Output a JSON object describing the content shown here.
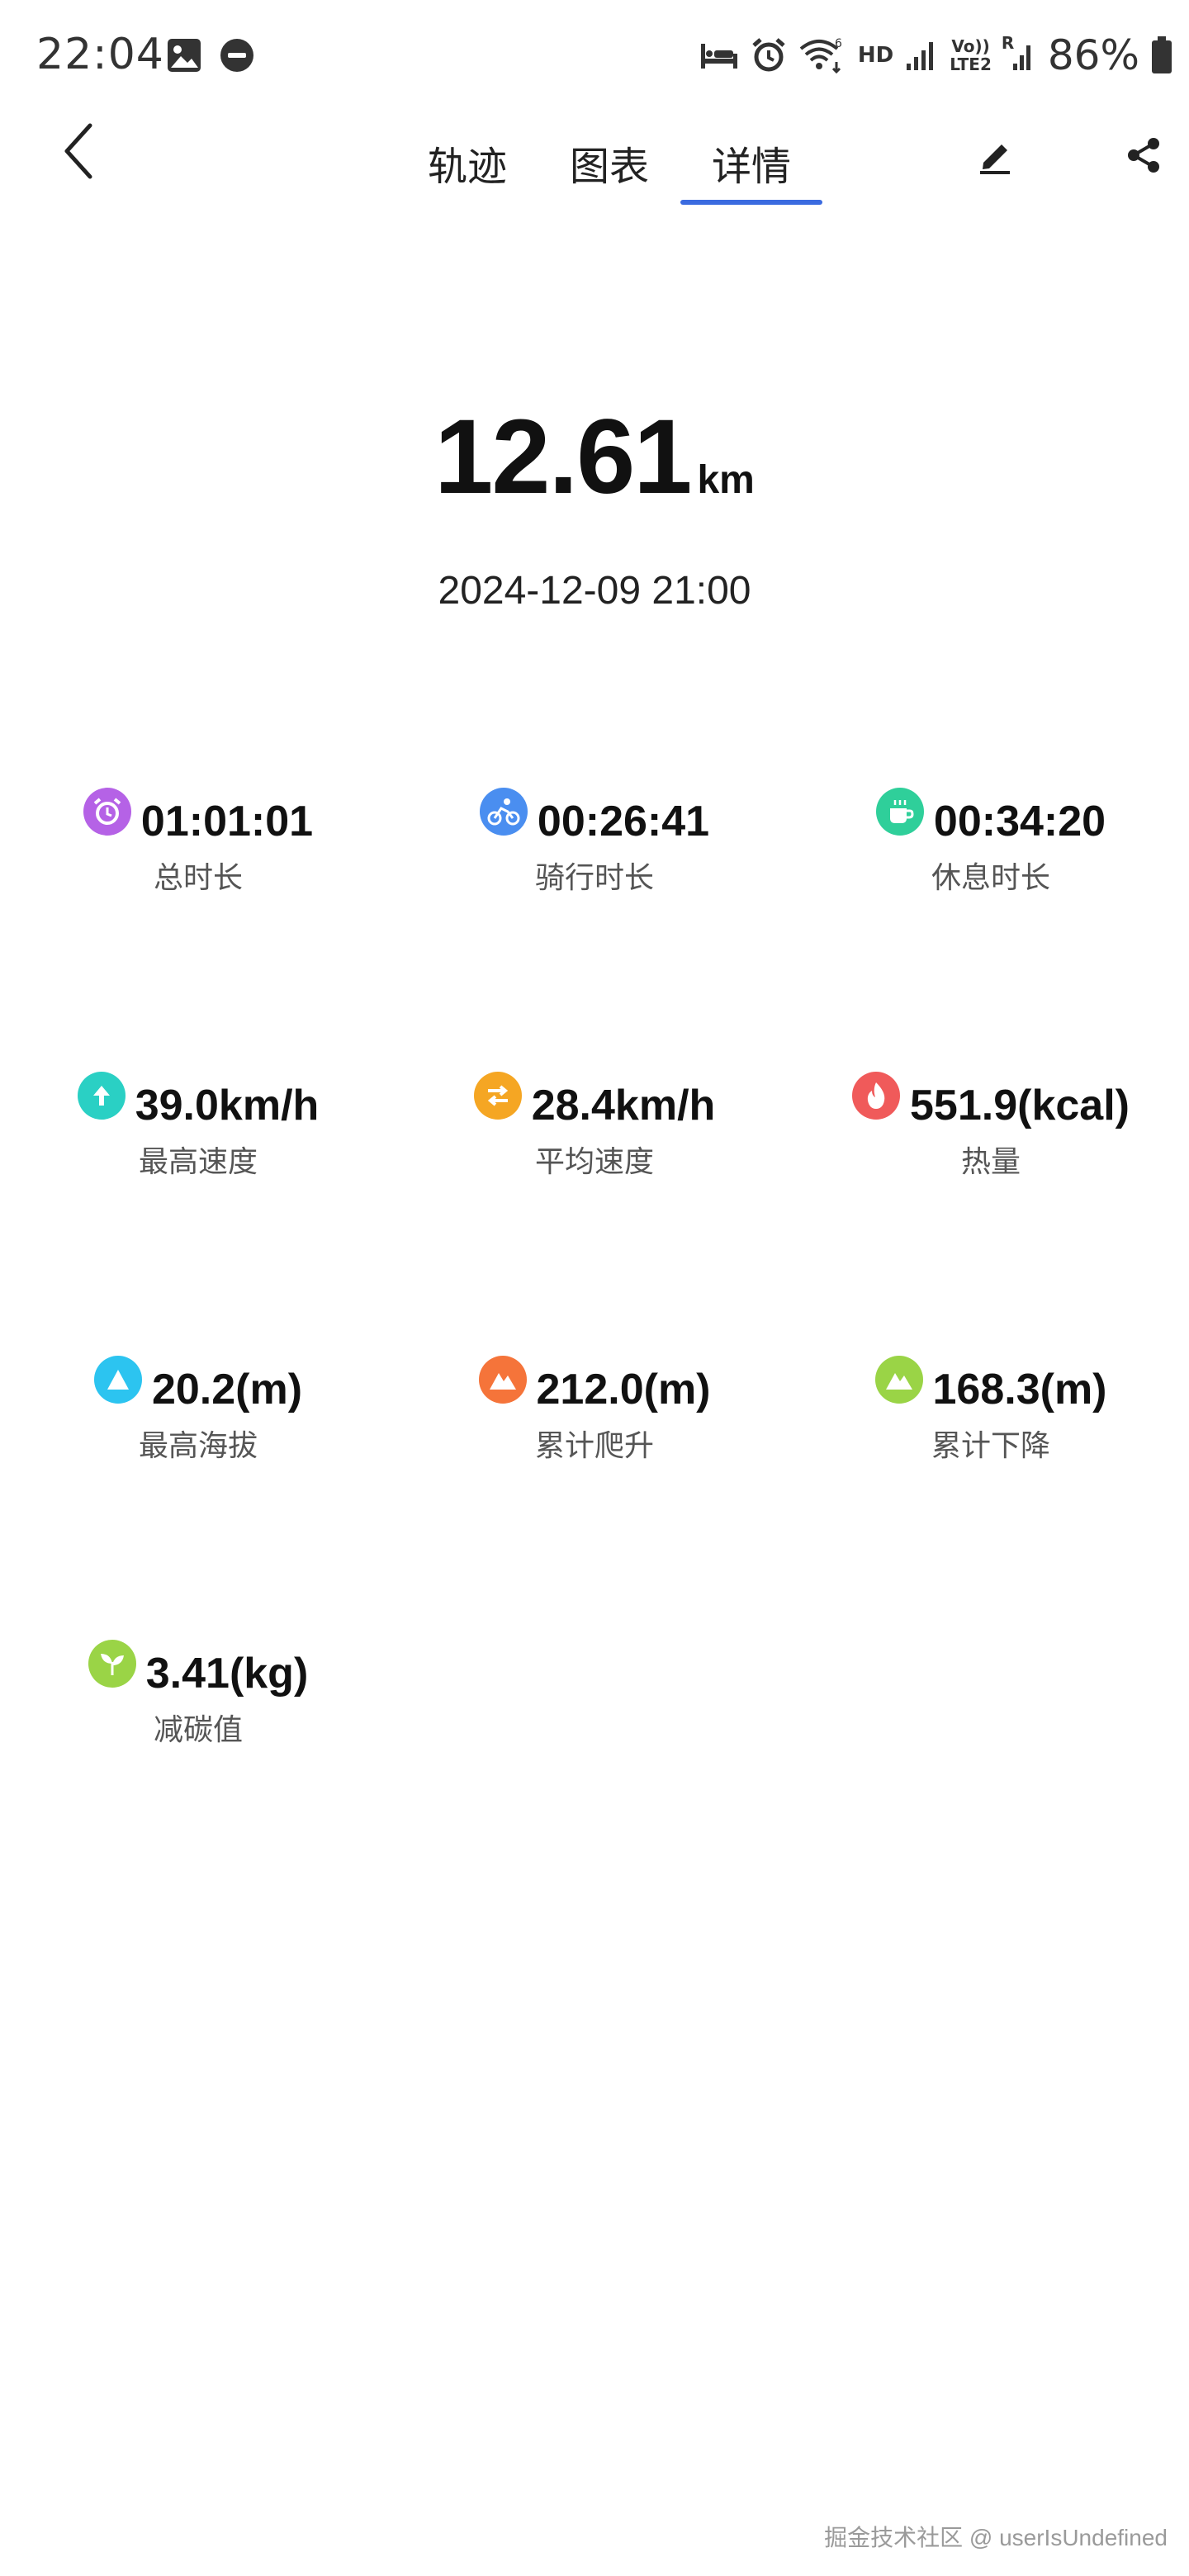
{
  "status_bar": {
    "time": "22:04",
    "hd": "HD",
    "volte_top": "Vo))",
    "volte_bottom": "LTE2",
    "roaming": "R",
    "wifi_sup": "6",
    "battery": "86%"
  },
  "nav": {
    "tabs": [
      {
        "label": "轨迹"
      },
      {
        "label": "图表"
      },
      {
        "label": "详情"
      }
    ],
    "active_tab": "详情",
    "accent_color": "#3b6be0"
  },
  "summary": {
    "distance": "12.61",
    "unit": "km",
    "datetime": "2024-12-09 21:00"
  },
  "stats": [
    {
      "value": "01:01:01",
      "label": "总时长",
      "icon": "alarm-clock-icon",
      "color": "#b562e6"
    },
    {
      "value": "00:26:41",
      "label": "骑行时长",
      "icon": "bicycle-icon",
      "color": "#4a8ef0"
    },
    {
      "value": "00:34:20",
      "label": "休息时长",
      "icon": "coffee-cup-icon",
      "color": "#2fcf9a"
    },
    {
      "value": "39.0km/h",
      "label": "最高速度",
      "icon": "arrow-up-icon",
      "color": "#2ad0c4"
    },
    {
      "value": "28.4km/h",
      "label": "平均速度",
      "icon": "swap-arrows-icon",
      "color": "#f5a623"
    },
    {
      "value": "551.9(kcal)",
      "label": "热量",
      "icon": "flame-icon",
      "color": "#f05a5a"
    },
    {
      "value": "20.2(m)",
      "label": "最高海拔",
      "icon": "triangle-peak-icon",
      "color": "#2cc4f0"
    },
    {
      "value": "212.0(m)",
      "label": "累计爬升",
      "icon": "mountain-icon",
      "color": "#f5743a"
    },
    {
      "value": "168.3(m)",
      "label": "累计下降",
      "icon": "mountain-icon",
      "color": "#9ad446"
    },
    {
      "value": "3.41(kg)",
      "label": "减碳值",
      "icon": "sprout-icon",
      "color": "#9ad446"
    }
  ],
  "watermark": "掘金技术社区 @ userIsUndefined"
}
